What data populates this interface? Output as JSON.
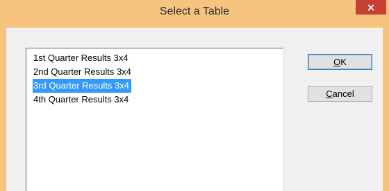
{
  "window": {
    "title": "Select a Table",
    "close_icon": "close-icon"
  },
  "list": {
    "items": [
      {
        "label": "1st Quarter Results 3x4",
        "selected": false
      },
      {
        "label": "2nd Quarter Results 3x4",
        "selected": false
      },
      {
        "label": "3rd Quarter Results 3x4",
        "selected": true
      },
      {
        "label": "4th Quarter Results 3x4",
        "selected": false
      }
    ]
  },
  "buttons": {
    "ok": {
      "mnemonic": "O",
      "rest": "K"
    },
    "cancel": {
      "mnemonic": "C",
      "rest": "ancel"
    }
  },
  "colors": {
    "frame": "#f6c47f",
    "close": "#c84031",
    "selection": "#3399ff",
    "client": "#f0f0f0"
  }
}
